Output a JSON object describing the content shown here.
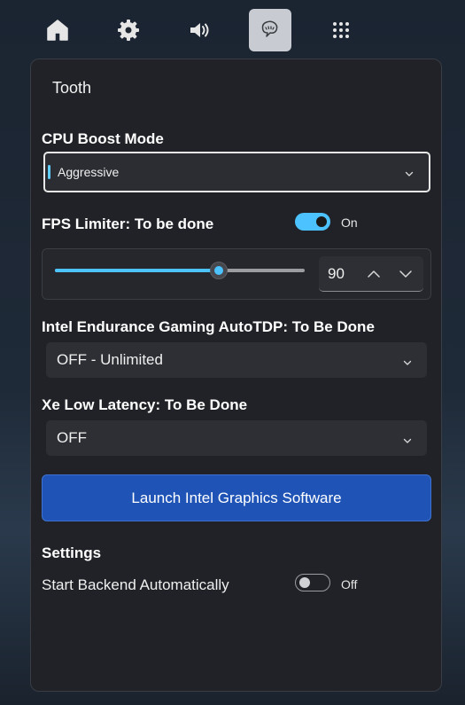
{
  "topbar": {
    "icons": [
      "home-icon",
      "gear-icon",
      "speaker-icon",
      "plugin-icon",
      "grid-icon"
    ],
    "active": "plugin-icon"
  },
  "panel": {
    "title": "Tooth",
    "cpu_boost": {
      "label": "CPU Boost Mode",
      "value": "Aggressive"
    },
    "fps_limiter": {
      "label": "FPS Limiter: To be done",
      "toggle_state": "On",
      "toggle_on": true,
      "slider_fraction": 0.655,
      "value": "90"
    },
    "autotdp": {
      "label": "Intel Endurance Gaming AutoTDP: To Be Done",
      "value": "OFF - Unlimited"
    },
    "xe_low_latency": {
      "label": "Xe Low Latency: To Be Done",
      "value": "OFF"
    },
    "launch_button": "Launch Intel Graphics Software",
    "settings": {
      "heading": "Settings",
      "start_backend_label": "Start Backend Automatically",
      "start_backend_state": "Off",
      "start_backend_on": false
    }
  },
  "colors": {
    "accent": "#4cc2ff",
    "primary_button": "#1f54b6",
    "panel_bg": "#202227"
  }
}
